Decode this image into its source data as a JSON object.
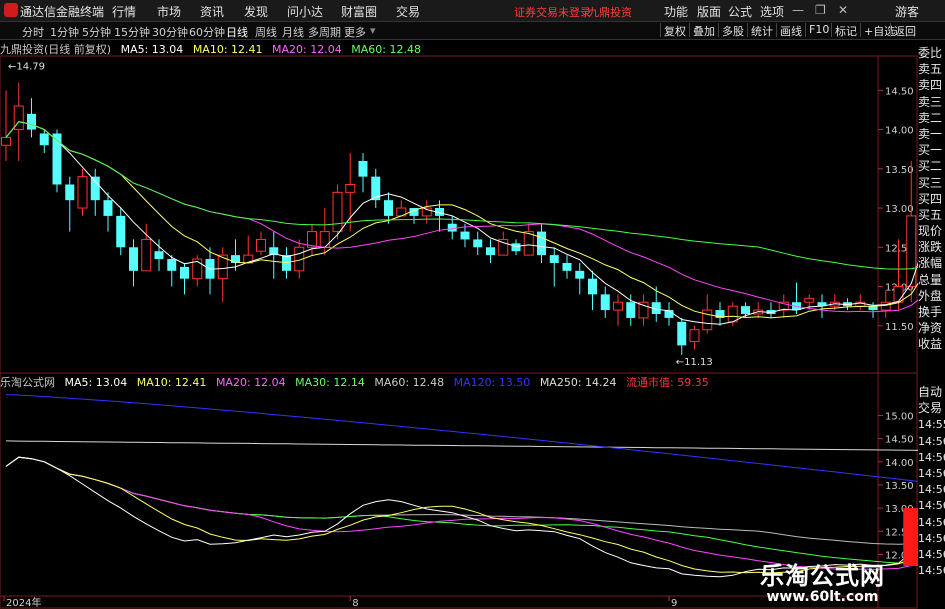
{
  "app": {
    "name": "通达信金融终端",
    "menu": [
      "行情",
      "市场",
      "资讯",
      "发现",
      "问小达",
      "财富圈",
      "交易"
    ],
    "alert": "证券交易未登录",
    "stock_name": "九鼎投资",
    "right_menu": [
      "功能",
      "版面",
      "公式",
      "选项"
    ],
    "user": "游客"
  },
  "timeframes": [
    "分时",
    "1分钟",
    "5分钟",
    "15分钟",
    "30分钟",
    "60分钟",
    "日线",
    "周线",
    "月线",
    "多周期",
    "更多"
  ],
  "active_timeframe": "日线",
  "toolbar_right": [
    "复权",
    "叠加",
    "多股",
    "统计",
    "画线",
    "F10",
    "标记",
    "+自选",
    "返回"
  ],
  "main_chart": {
    "label": "九鼎投资(日线 前复权)",
    "ma": [
      {
        "text": "MA5: 13.04",
        "color": "#ffffff"
      },
      {
        "text": "MA10: 12.41",
        "color": "#ffff66"
      },
      {
        "text": "MA20: 12.04",
        "color": "#ff66ff"
      },
      {
        "text": "MA60: 12.48",
        "color": "#66ff66"
      }
    ],
    "high_label": "14.79",
    "low_label": "11.13",
    "yticks": [
      "14.50",
      "14.00",
      "13.50",
      "13.00",
      "12.50",
      "12.00",
      "11.50"
    ]
  },
  "sub_chart": {
    "label": "乐淘公式网",
    "ma": [
      {
        "text": "MA5: 13.04",
        "color": "#ffffff"
      },
      {
        "text": "MA10: 12.41",
        "color": "#ffff66"
      },
      {
        "text": "MA20: 12.04",
        "color": "#ff66ff"
      },
      {
        "text": "MA30: 12.14",
        "color": "#66ff66"
      },
      {
        "text": "MA60: 12.48",
        "color": "#cccccc"
      },
      {
        "text": "MA120: 13.50",
        "color": "#3333ff"
      },
      {
        "text": "MA250: 14.24",
        "color": "#dddddd"
      }
    ],
    "cap": {
      "text": "流通市值: 59.35",
      "color": "#ff3333"
    },
    "yticks": [
      "15.00",
      "14.50",
      "14.00",
      "13.50",
      "13.00",
      "12.50",
      "12.00"
    ]
  },
  "right_panel_top": [
    "委比",
    "卖五",
    "卖四",
    "卖三",
    "卖二",
    "卖一",
    "买一",
    "买二",
    "买三",
    "买四",
    "买五",
    "现价",
    "涨跌",
    "涨幅",
    "总量",
    "外盘",
    "换手",
    "净资",
    "收益"
  ],
  "right_panel_bottom": [
    "自动",
    "交易",
    "14:55",
    "14:56",
    "14:56",
    "14:56",
    "14:56",
    "14:56",
    "14:56",
    "14:56",
    "14:56",
    "14:56"
  ],
  "x_labels": [
    "2024年",
    "8",
    "9"
  ],
  "watermark": {
    "title": "乐淘公式网",
    "url": "www.60lt.com"
  },
  "chart_data": {
    "type": "candlestick",
    "ylim": [
      11.0,
      14.95
    ],
    "candles": [
      [
        13.8,
        13.9,
        13.6,
        14.5
      ],
      [
        14.0,
        14.3,
        13.6,
        14.6
      ],
      [
        14.2,
        14.0,
        13.9,
        14.4
      ],
      [
        13.95,
        13.8,
        13.7,
        14.0
      ],
      [
        13.95,
        13.3,
        13.2,
        14.0
      ],
      [
        13.3,
        13.1,
        12.7,
        13.4
      ],
      [
        13.0,
        13.4,
        12.9,
        13.5
      ],
      [
        13.4,
        13.1,
        12.9,
        13.5
      ],
      [
        13.1,
        12.9,
        12.7,
        13.2
      ],
      [
        12.9,
        12.5,
        12.4,
        13.0
      ],
      [
        12.5,
        12.2,
        12.0,
        12.6
      ],
      [
        12.2,
        12.6,
        12.2,
        12.8
      ],
      [
        12.45,
        12.35,
        12.2,
        12.6
      ],
      [
        12.35,
        12.2,
        12.0,
        12.4
      ],
      [
        12.25,
        12.1,
        11.9,
        12.3
      ],
      [
        12.1,
        12.35,
        12.0,
        12.4
      ],
      [
        12.35,
        12.1,
        11.9,
        12.5
      ],
      [
        12.1,
        12.4,
        11.8,
        12.5
      ],
      [
        12.4,
        12.3,
        12.2,
        12.6
      ],
      [
        12.3,
        12.4,
        12.3,
        12.65
      ],
      [
        12.45,
        12.6,
        12.4,
        12.7
      ],
      [
        12.5,
        12.4,
        12.1,
        12.7
      ],
      [
        12.4,
        12.2,
        12.1,
        12.5
      ],
      [
        12.2,
        12.5,
        12.1,
        12.6
      ],
      [
        12.5,
        12.7,
        12.4,
        12.8
      ],
      [
        12.5,
        12.7,
        12.4,
        13.0
      ],
      [
        12.7,
        13.2,
        12.6,
        13.3
      ],
      [
        13.2,
        13.3,
        12.7,
        13.7
      ],
      [
        13.6,
        13.4,
        13.2,
        13.7
      ],
      [
        13.4,
        13.1,
        13.0,
        13.5
      ],
      [
        13.1,
        12.9,
        12.8,
        13.2
      ],
      [
        12.9,
        13.0,
        12.9,
        13.1
      ],
      [
        13.0,
        12.9,
        12.8,
        13.0
      ],
      [
        12.9,
        13.0,
        12.8,
        13.1
      ],
      [
        13.0,
        12.9,
        12.7,
        13.1
      ],
      [
        12.8,
        12.7,
        12.6,
        12.9
      ],
      [
        12.7,
        12.6,
        12.5,
        12.8
      ],
      [
        12.6,
        12.5,
        12.4,
        12.7
      ],
      [
        12.5,
        12.4,
        12.3,
        12.6
      ],
      [
        12.4,
        12.6,
        12.4,
        12.7
      ],
      [
        12.55,
        12.45,
        12.4,
        12.6
      ],
      [
        12.4,
        12.7,
        12.4,
        12.8
      ],
      [
        12.7,
        12.4,
        12.3,
        12.8
      ],
      [
        12.4,
        12.3,
        12.0,
        12.5
      ],
      [
        12.3,
        12.2,
        12.1,
        12.4
      ],
      [
        12.2,
        12.1,
        11.9,
        12.3
      ],
      [
        12.1,
        11.9,
        11.7,
        12.2
      ],
      [
        11.9,
        11.7,
        11.6,
        12.0
      ],
      [
        11.7,
        11.8,
        11.5,
        11.9
      ],
      [
        11.8,
        11.6,
        11.5,
        11.9
      ],
      [
        11.6,
        11.8,
        11.5,
        11.9
      ],
      [
        11.8,
        11.65,
        11.55,
        12.0
      ],
      [
        11.7,
        11.6,
        11.5,
        11.8
      ],
      [
        11.55,
        11.25,
        11.13,
        11.6
      ],
      [
        11.3,
        11.45,
        11.2,
        11.5
      ],
      [
        11.45,
        11.7,
        11.4,
        11.9
      ],
      [
        11.7,
        11.6,
        11.5,
        11.8
      ],
      [
        11.55,
        11.75,
        11.5,
        11.8
      ],
      [
        11.75,
        11.65,
        11.6,
        11.8
      ],
      [
        11.65,
        11.7,
        11.6,
        11.8
      ],
      [
        11.7,
        11.65,
        11.6,
        11.8
      ],
      [
        11.7,
        11.8,
        11.6,
        11.9
      ],
      [
        11.8,
        11.7,
        11.65,
        12.05
      ],
      [
        11.8,
        11.85,
        11.7,
        11.9
      ],
      [
        11.8,
        11.75,
        11.6,
        11.9
      ],
      [
        11.75,
        11.8,
        11.7,
        11.9
      ],
      [
        11.8,
        11.75,
        11.7,
        11.85
      ],
      [
        11.75,
        11.8,
        11.7,
        11.9
      ],
      [
        11.75,
        11.7,
        11.6,
        11.8
      ],
      [
        11.7,
        11.8,
        11.6,
        11.95
      ],
      [
        11.8,
        12.0,
        11.7,
        12.6
      ],
      [
        12.0,
        12.9,
        11.8,
        13.6
      ],
      [
        13.2,
        14.2,
        13.1,
        14.3
      ],
      [
        14.0,
        13.15,
        13.0,
        14.5
      ],
      [
        13.15,
        13.0,
        12.9,
        13.4
      ]
    ]
  }
}
